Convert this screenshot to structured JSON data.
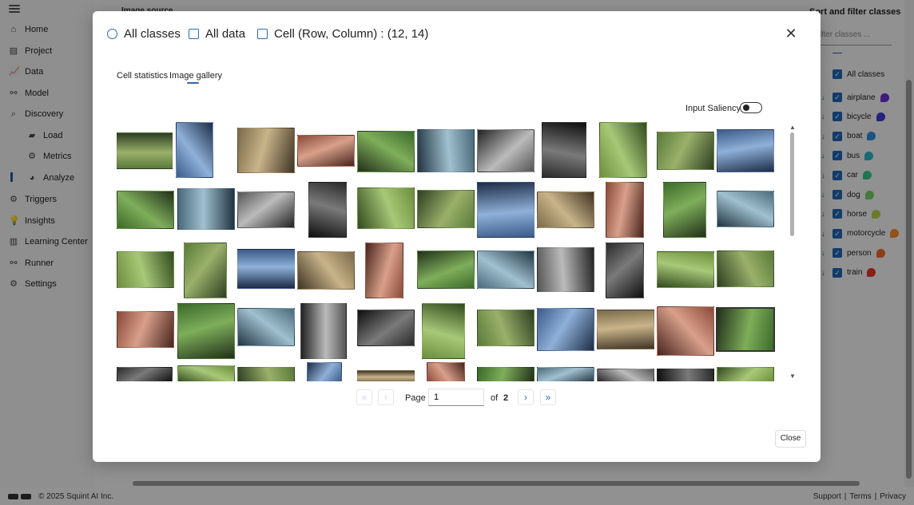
{
  "background": {
    "top_label": "Image source",
    "sidebar": {
      "items": [
        {
          "label": "Home",
          "icon": "home-icon",
          "glyph": "⌂"
        },
        {
          "label": "Project",
          "icon": "project-icon",
          "glyph": "▤"
        },
        {
          "label": "Data",
          "icon": "data-icon",
          "glyph": "📈"
        },
        {
          "label": "Model",
          "icon": "model-icon",
          "glyph": "⚯"
        },
        {
          "label": "Discovery",
          "icon": "discovery-icon",
          "glyph": "⌕"
        },
        {
          "label": "Load",
          "icon": "folder-icon",
          "glyph": "▰"
        },
        {
          "label": "Metrics",
          "icon": "metrics-icon",
          "glyph": "⚙"
        },
        {
          "label": "Analyze",
          "icon": "analyze-icon",
          "glyph": "◕"
        },
        {
          "label": "Triggers",
          "icon": "triggers-icon",
          "glyph": "⚙"
        },
        {
          "label": "Insights",
          "icon": "insights-icon",
          "glyph": "💡"
        },
        {
          "label": "Learning Center",
          "icon": "learning-icon",
          "glyph": "▥"
        },
        {
          "label": "Runner",
          "icon": "runner-icon",
          "glyph": "⚯"
        },
        {
          "label": "Settings",
          "icon": "settings-icon",
          "glyph": "⚙"
        }
      ]
    },
    "right_panel": {
      "title": "Sort and filter classes",
      "search_placeholder": "ilter classes ...",
      "all_label": "All classes",
      "classes": [
        {
          "label": "airplane",
          "color": "#6b2fd6"
        },
        {
          "label": "bicycle",
          "color": "#3b3fd8"
        },
        {
          "label": "boat",
          "color": "#2f8fe0"
        },
        {
          "label": "bus",
          "color": "#2db7c8"
        },
        {
          "label": "car",
          "color": "#3cc98a"
        },
        {
          "label": "dog",
          "color": "#79d16a"
        },
        {
          "label": "horse",
          "color": "#b9d44f"
        },
        {
          "label": "motorcycle",
          "color": "#ff8a2a"
        },
        {
          "label": "person",
          "color": "#f26b2a"
        },
        {
          "label": "train",
          "color": "#e8362a"
        }
      ]
    },
    "footer": {
      "copyright": "© 2025 Squint AI Inc.",
      "support": "Support",
      "terms": "Terms",
      "privacy": "Privacy",
      "sep": "|"
    }
  },
  "modal": {
    "header": {
      "classes": "All classes",
      "data": "All data",
      "cell": "Cell (Row, Column) : (12, 14)"
    },
    "tabs": [
      "Cell statistics",
      "Image gallery"
    ],
    "active_tab": "Image gallery",
    "saliency_label": "Input Saliency",
    "saliency_on": false,
    "pagination": {
      "page_label": "Page",
      "page_value": "1",
      "of_label": "of",
      "total_pages": "2"
    },
    "close_label": "Close",
    "accent": "#2b6cb0",
    "image_count_visible": 55
  }
}
